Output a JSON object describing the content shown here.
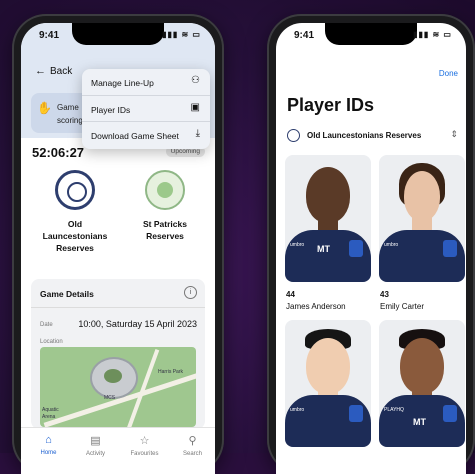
{
  "left_screen": {
    "status_time": "9:41",
    "status_icons": "▮▮▮ ≋ ▭",
    "back_label": "Back",
    "game_card_line1": "Game",
    "game_card_line2": "scoring",
    "menu": {
      "items": [
        {
          "label": "Manage Line-Up",
          "icon": "people-icon",
          "glyph": "⚇"
        },
        {
          "label": "Player IDs",
          "icon": "id-card-icon",
          "glyph": "▣"
        },
        {
          "label": "Download Game Sheet",
          "icon": "download-icon",
          "glyph": "⤓"
        }
      ]
    },
    "countdown": "52:06:27",
    "status_badge": "Upcoming",
    "teams": [
      {
        "name_line1": "Old",
        "name_line2": "Launcestonians",
        "name_line3": "Reserves"
      },
      {
        "name_line1": "St Patricks",
        "name_line2": "Reserves",
        "name_line3": ""
      }
    ],
    "game_details": {
      "heading": "Game Details",
      "date_label": "Date",
      "date_value": "10:00, Saturday 15 April 2023",
      "location_label": "Location",
      "map_labels": [
        "MCS",
        "Harris Park",
        "Aquatic",
        "Arena"
      ]
    },
    "tabs": [
      {
        "label": "Home",
        "glyph": "⌂"
      },
      {
        "label": "Activity",
        "glyph": "▤"
      },
      {
        "label": "Favourites",
        "glyph": "☆"
      },
      {
        "label": "Search",
        "glyph": "⚲"
      }
    ]
  },
  "right_screen": {
    "status_time": "9:41",
    "status_icons": "▮▮▮ ≋ ▭",
    "done_label": "Done",
    "title": "Player IDs",
    "team_selector": "Old Launcestonians Reserves",
    "selector_glyph": "⌃⌄",
    "players": [
      {
        "number": "44",
        "name": "James Anderson",
        "skin": "#5a3a27",
        "hair": "#1a1a1a",
        "sponsor": "MT"
      },
      {
        "number": "43",
        "name": "Emily Carter",
        "skin": "#e8c2a6",
        "hair": "#3a2416",
        "sponsor": ""
      },
      {
        "number": "",
        "name": "",
        "skin": "#f0cdb0",
        "hair": "#151515",
        "sponsor": ""
      },
      {
        "number": "",
        "name": "",
        "skin": "#8a5a3c",
        "hair": "#161010",
        "sponsor": "MT"
      }
    ]
  },
  "colors": {
    "background": "#2a0f3d",
    "accent_blue": "#1a5fd1",
    "shirt_navy": "#1d2c57"
  }
}
